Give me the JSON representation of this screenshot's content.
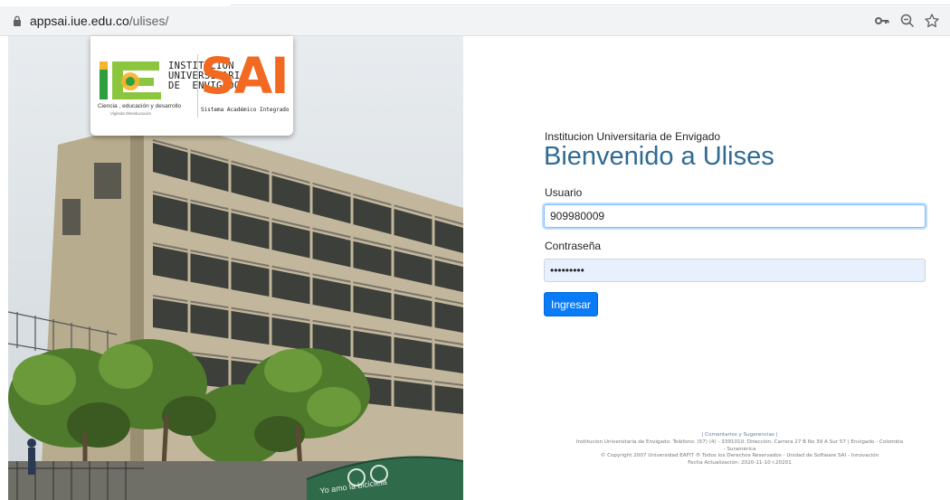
{
  "browser": {
    "url_host": "appsai.iue.edu.co",
    "url_path": "/ulises/"
  },
  "logos": {
    "iue_lines": [
      "INSTITUCIÓN",
      "UNIVERSITARIA",
      "DE  ENVIGADO"
    ],
    "iue_slogan": "Ciencia , educación y desarrollo",
    "iue_sub": "Vigilada Mineducación",
    "sai": "SAI",
    "sai_sub": "Sistema Académico Integrado"
  },
  "login": {
    "institution": "Institucion Universitaria de Envigado",
    "title": "Bienvenido a Ulises",
    "user_label": "Usuario",
    "user_value": "909980009",
    "password_label": "Contraseña",
    "password_value": "•••••••••",
    "submit_label": "Ingresar"
  },
  "footer": {
    "links": "| Comentarios y Sugerencias |",
    "address_line1": "Institucion Universitaria de Envigado: Teléfono: (57) (4) - 3391010: Dirección: Carrera 27 B No 39 A Sur 57 | Envigado - Colombia",
    "address_line2": "- Suramérica",
    "copyright": "© Copyright 2007 Universidad EAFIT ® Todos los Derechos Reservados - Unidad de Software SAI - Innovación",
    "updated": "Fecha Actualización: 2020-11-10 r.20201"
  },
  "photo_sign": "Yo amo la bicicleta",
  "colors": {
    "accent": "#2f6a94",
    "button": "#0a7bf7",
    "sai_orange": "#f26a21",
    "iue_green": "#2e9e3e"
  }
}
